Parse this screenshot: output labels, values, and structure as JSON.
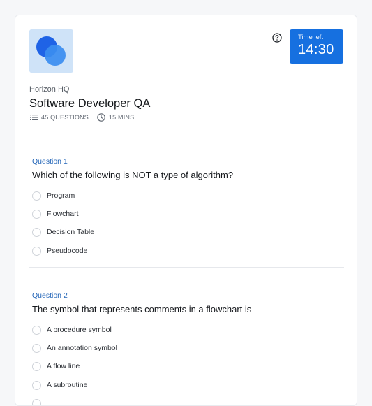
{
  "header": {
    "logo_icon": "overlapping-circles-logo-icon",
    "help_icon": "question-circle-icon",
    "timer": {
      "label": "Time left",
      "value": "14:30"
    },
    "org_name": "Horizon HQ",
    "title": "Software Developer QA",
    "meta": {
      "questions_icon": "list-icon",
      "questions": "45 QUESTIONS",
      "duration_icon": "clock-icon",
      "duration": "15 MINS"
    }
  },
  "questions": [
    {
      "number": "Question 1",
      "text": "Which of the following is NOT a type of algorithm?",
      "options": [
        "Program",
        "Flowchart",
        "Decision Table",
        "Pseudocode"
      ]
    },
    {
      "number": "Question 2",
      "text": "The symbol that represents comments in a flowchart is",
      "options": [
        "A procedure symbol",
        "An annotation symbol",
        "A flow line",
        "A subroutine"
      ]
    }
  ],
  "colors": {
    "accent": "#1670e0",
    "logo_bg": "#cfe3f8",
    "question_number": "#2466b8"
  }
}
